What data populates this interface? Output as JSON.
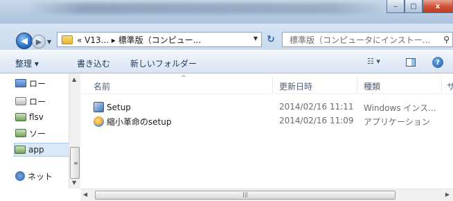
{
  "window": {
    "caption": {
      "minimize": "‒",
      "maximize": "□",
      "close": "x"
    }
  },
  "address": {
    "path": "« V13... ▸ 標準版（コンピュー...",
    "search_placeholder": "標準版（コンピュータにインストー..."
  },
  "toolbar": {
    "organize": "整理 ▾",
    "burn": "書き込む",
    "new_folder": "新しいフォルダー",
    "view": "☷ ▾",
    "help": "?"
  },
  "nav": {
    "items": [
      {
        "label": "ロー",
        "icon": "desktop-icon"
      },
      {
        "label": "ロー",
        "icon": "drive-icon"
      },
      {
        "label": "flsv",
        "icon": "network-drive-icon"
      },
      {
        "label": "ソー",
        "icon": "network-drive-icon"
      },
      {
        "label": "app",
        "icon": "network-drive-icon",
        "selected": true
      },
      {
        "label": "ネット",
        "icon": "network-icon"
      }
    ]
  },
  "columns": {
    "name": "名前",
    "date": "更新日時",
    "type": "種類",
    "size": "サ"
  },
  "files": [
    {
      "name": "Setup",
      "date": "2014/02/16 11:11",
      "type": "Windows インス...",
      "icon": "setup-icon"
    },
    {
      "name": "縮小革命のsetup",
      "date": "2014/02/16 11:09",
      "type": "アプリケーション",
      "icon": "application-icon"
    }
  ],
  "scrollbars": {
    "up": "▲",
    "down": "▼",
    "left": "◀",
    "right": "▶",
    "grip_v": "≡",
    "grip_h": "|||"
  }
}
